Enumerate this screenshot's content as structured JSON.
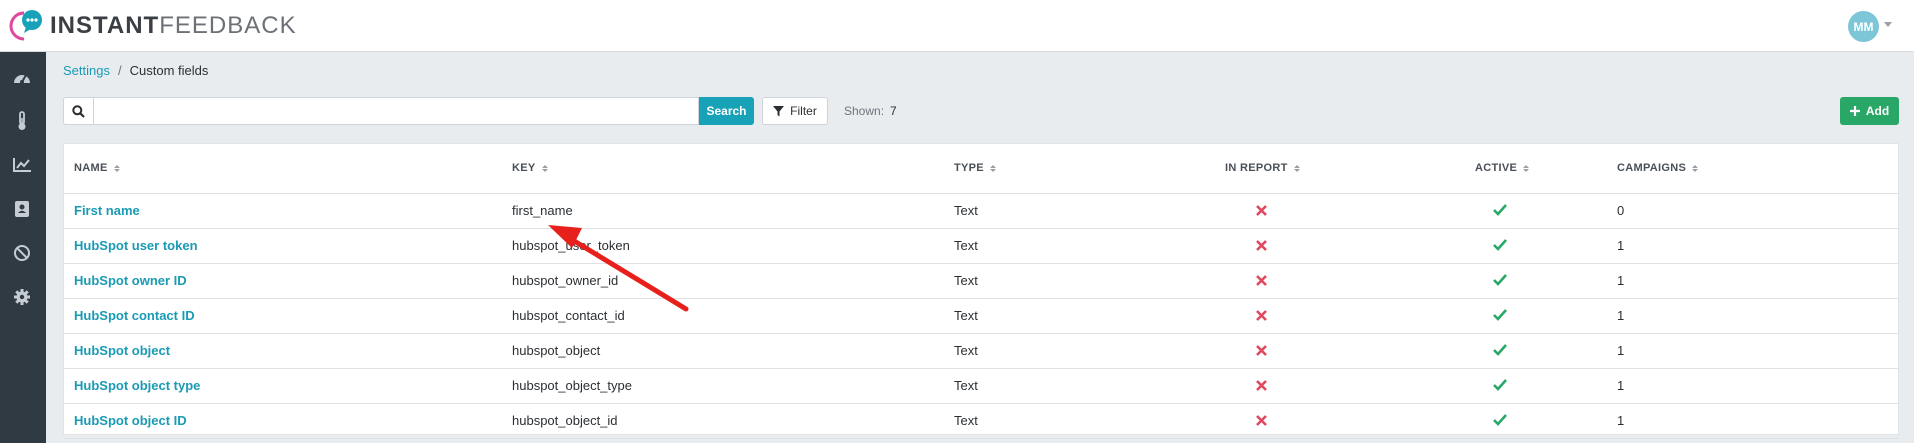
{
  "brand": {
    "name_bold": "INSTANT",
    "name_light": "FEEDBACK",
    "colors": {
      "brand_pink": "#e0479e",
      "brand_teal": "#17a2b8"
    }
  },
  "user": {
    "initials": "MM",
    "avatar_color": "#7cc6d7"
  },
  "sidebar": {
    "items": [
      {
        "icon": "dashboard-gauge-icon"
      },
      {
        "icon": "thermometer-icon"
      },
      {
        "icon": "line-chart-icon"
      },
      {
        "icon": "contact-book-icon"
      },
      {
        "icon": "ban-icon"
      },
      {
        "icon": "gear-icon"
      }
    ]
  },
  "breadcrumb": {
    "parent": "Settings",
    "separator": "/",
    "current": "Custom fields"
  },
  "toolbar": {
    "search_value": "",
    "search_placeholder": "",
    "search_label": "Search",
    "filter_label": "Filter",
    "shown_label": "Shown:",
    "shown_count": "7",
    "add_label": "Add"
  },
  "table": {
    "columns": [
      "NAME",
      "KEY",
      "TYPE",
      "IN REPORT",
      "ACTIVE",
      "CAMPAIGNS"
    ],
    "rows": [
      {
        "name": "First name",
        "key": "first_name",
        "type": "Text",
        "in_report": false,
        "active": true,
        "campaigns": "0"
      },
      {
        "name": "HubSpot user token",
        "key": "hubspot_user_token",
        "type": "Text",
        "in_report": false,
        "active": true,
        "campaigns": "1"
      },
      {
        "name": "HubSpot owner ID",
        "key": "hubspot_owner_id",
        "type": "Text",
        "in_report": false,
        "active": true,
        "campaigns": "1"
      },
      {
        "name": "HubSpot contact ID",
        "key": "hubspot_contact_id",
        "type": "Text",
        "in_report": false,
        "active": true,
        "campaigns": "1"
      },
      {
        "name": "HubSpot object",
        "key": "hubspot_object",
        "type": "Text",
        "in_report": false,
        "active": true,
        "campaigns": "1"
      },
      {
        "name": "HubSpot object type",
        "key": "hubspot_object_type",
        "type": "Text",
        "in_report": false,
        "active": true,
        "campaigns": "1"
      },
      {
        "name": "HubSpot object ID",
        "key": "hubspot_object_id",
        "type": "Text",
        "in_report": false,
        "active": true,
        "campaigns": "1"
      }
    ]
  },
  "annotation": {
    "arrow_color": "#e8201b"
  },
  "status_colors": {
    "false": "#e0485e",
    "true": "#28a767"
  }
}
